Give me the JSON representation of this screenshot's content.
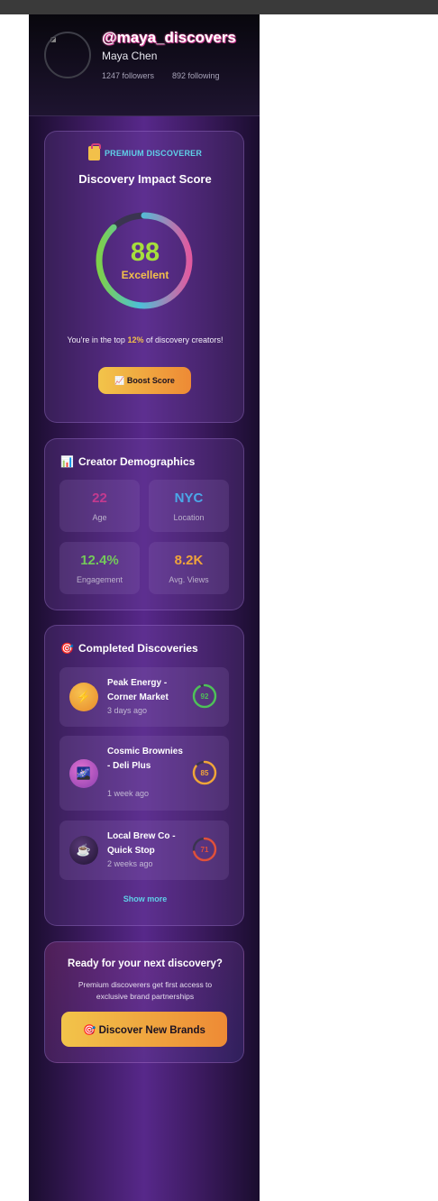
{
  "profile": {
    "handle": "@maya_discovers",
    "name": "Maya Chen",
    "followers": "1247 followers",
    "following": "892 following"
  },
  "impact": {
    "badge": "PREMIUM DISCOVERER",
    "title": "Discovery Impact Score",
    "score": "88",
    "score_fraction": 0.88,
    "label": "Excellent",
    "rank_prefix": "You're in the top ",
    "rank_value": "12%",
    "rank_suffix": " of discovery creators!",
    "boost_label": "📈 Boost Score"
  },
  "demographics": {
    "title": "Creator Demographics",
    "title_emoji": "📊",
    "stats": [
      {
        "value": "22",
        "label": "Age",
        "color": "#c23a8f"
      },
      {
        "value": "NYC",
        "label": "Location",
        "color": "#4aa8e8"
      },
      {
        "value": "12.4%",
        "label": "Engagement",
        "color": "#74c95a"
      },
      {
        "value": "8.2K",
        "label": "Avg. Views",
        "color": "#f0a43a"
      }
    ]
  },
  "discoveries": {
    "title": "Completed Discoveries",
    "title_emoji": "🎯",
    "items": [
      {
        "name": "Peak Energy - Corner Market",
        "time": "3 days ago",
        "score": "92",
        "score_fraction": 0.92,
        "icon": "⚡",
        "icon_name": "lightning-icon",
        "ring_color": "#4fc05a"
      },
      {
        "name": "Cosmic Brownies - Deli Plus",
        "time": "1 week ago",
        "score": "85",
        "score_fraction": 0.85,
        "icon": "🌌",
        "icon_name": "galaxy-icon",
        "ring_color": "#f0a43a"
      },
      {
        "name": "Local Brew Co - Quick Stop",
        "time": "2 weeks ago",
        "score": "71",
        "score_fraction": 0.71,
        "icon": "☕",
        "icon_name": "coffee-icon",
        "ring_color": "#e0503c"
      }
    ],
    "show_more": "Show more"
  },
  "cta": {
    "title": "Ready for your next discovery?",
    "subtitle": "Premium discoverers get first access to exclusive brand partnerships",
    "button": "🎯 Discover New Brands"
  }
}
